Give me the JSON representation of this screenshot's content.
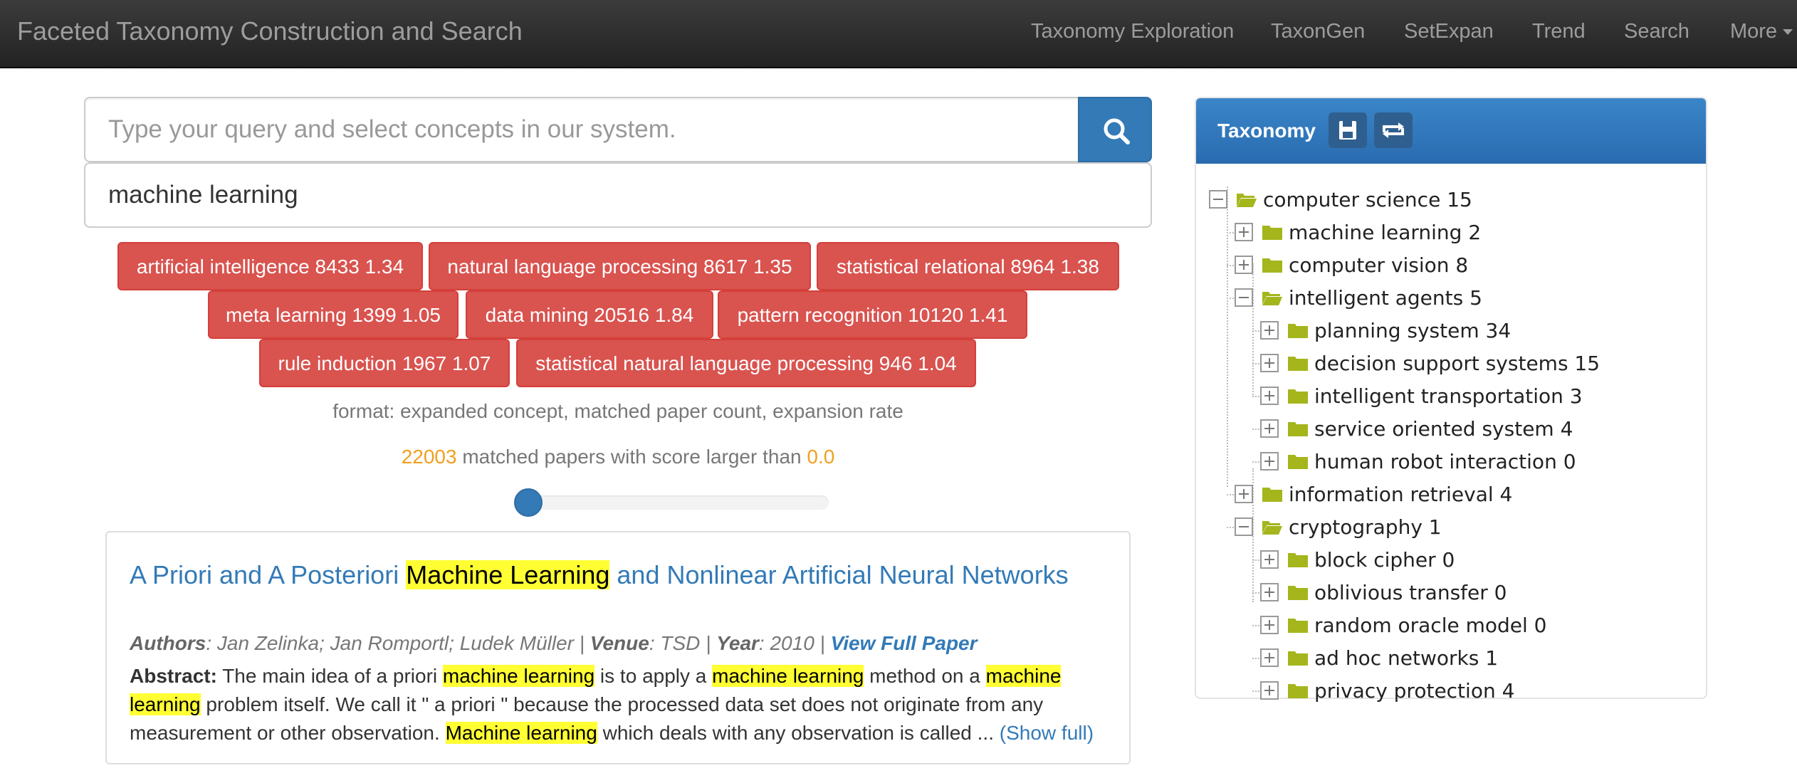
{
  "navbar": {
    "brand": "Faceted Taxonomy Construction and Search",
    "items": [
      {
        "label": "Taxonomy Exploration"
      },
      {
        "label": "TaxonGen"
      },
      {
        "label": "SetExpan"
      },
      {
        "label": "Trend"
      },
      {
        "label": "Search"
      },
      {
        "label": "More"
      }
    ]
  },
  "search": {
    "placeholder": "Type your query and select concepts in our system.",
    "query": "machine learning",
    "button_icon": "search-icon"
  },
  "concepts": [
    {
      "label": "artificial intelligence 8433 1.34"
    },
    {
      "label": "natural language processing 8617 1.35"
    },
    {
      "label": "statistical relational 8964 1.38"
    },
    {
      "label": "meta learning 1399 1.05"
    },
    {
      "label": "data mining 20516 1.84"
    },
    {
      "label": "pattern recognition 10120 1.41"
    },
    {
      "label": "rule induction 1967 1.07"
    },
    {
      "label": "statistical natural language processing 946 1.04"
    }
  ],
  "format_note": "format: expanded concept, matched paper count, expansion rate",
  "results": {
    "count": "22003",
    "text": " matched papers with score larger than ",
    "threshold": "0.0",
    "slider_value": 0.0
  },
  "paper": {
    "title_pre": "A Priori and A Posteriori ",
    "title_hl": "Machine Learning",
    "title_post": " and Nonlinear Artificial Neural Networks",
    "authors_label": "Authors",
    "authors": ": Jan Zelinka; Jan Romportl; Ludek Müller | ",
    "venue_label": "Venue",
    "venue": ": TSD | ",
    "year_label": "Year",
    "year": ": 2010 | ",
    "view_link": "View Full Paper",
    "abstract_label": "Abstract:",
    "abstract_parts": {
      "p1": " The main idea of a priori ",
      "h1": "machine learning",
      "p2": " is to apply a ",
      "h2": "machine learning",
      "p3": " method on a ",
      "h3": "machine learning",
      "p4": " problem itself. We call it \" a priori \" because the processed data set does not originate from any measurement or other observation. ",
      "h4": "Machine learning",
      "p5": " which deals with any observation is called ... "
    },
    "show_full": "(Show full)"
  },
  "taxonomy": {
    "title": "Taxonomy",
    "save_icon": "save-icon",
    "refresh_icon": "refresh-icon",
    "nodes": [
      {
        "label": "computer science 15",
        "expanded": true
      },
      {
        "label": "machine learning 2",
        "expanded": false
      },
      {
        "label": "computer vision 8",
        "expanded": false
      },
      {
        "label": "intelligent agents 5",
        "expanded": true
      },
      {
        "label": "planning system 34",
        "expanded": false
      },
      {
        "label": "decision support systems 15",
        "expanded": false
      },
      {
        "label": "intelligent transportation 3",
        "expanded": false
      },
      {
        "label": "service oriented system 4",
        "expanded": false
      },
      {
        "label": "human robot interaction 0",
        "expanded": false
      },
      {
        "label": "information retrieval 4",
        "expanded": false
      },
      {
        "label": "cryptography 1",
        "expanded": true
      },
      {
        "label": "block cipher 0",
        "expanded": false
      },
      {
        "label": "oblivious transfer 0",
        "expanded": false
      },
      {
        "label": "random oracle model 0",
        "expanded": false
      },
      {
        "label": "ad hoc networks 1",
        "expanded": false
      },
      {
        "label": "privacy protection 4",
        "expanded": false
      }
    ]
  },
  "colors": {
    "concept_bg": "#d9534f",
    "primary": "#337ab7",
    "highlight": "#ffff33",
    "folder": "#a4b61c"
  }
}
